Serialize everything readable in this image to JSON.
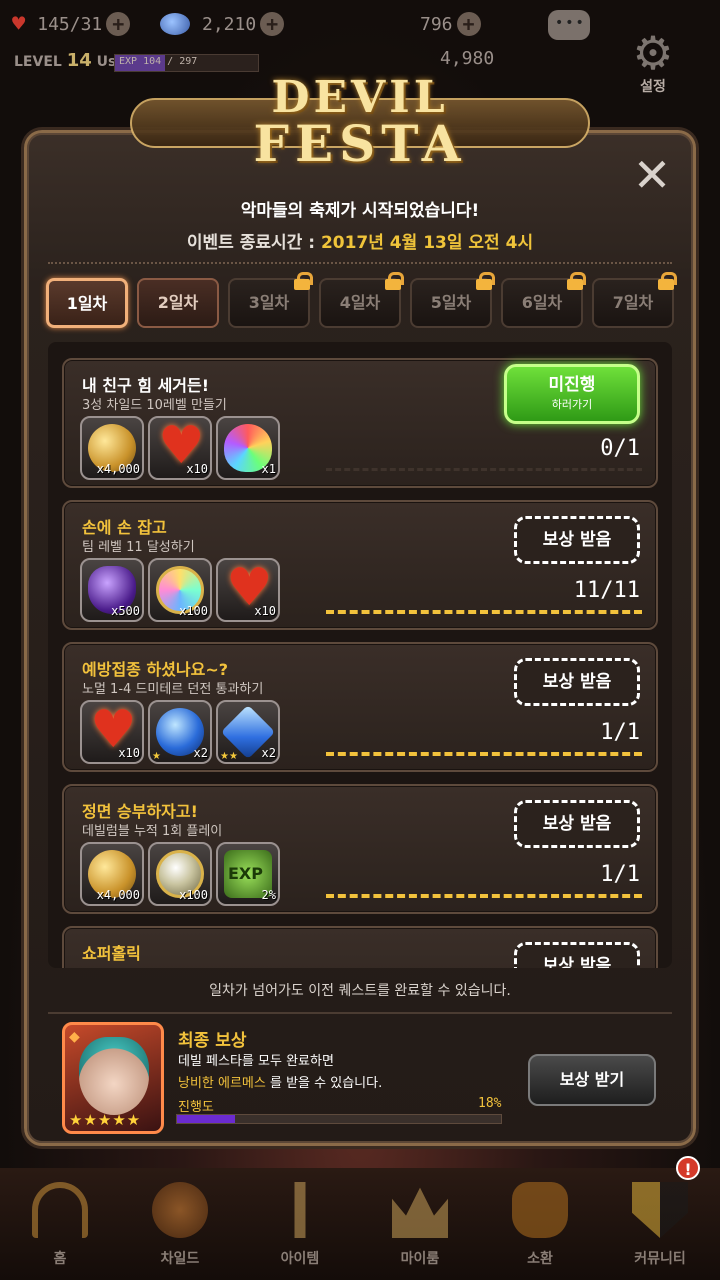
{
  "topbar": {
    "stamina": "145/31",
    "gems": "2,210",
    "gold": "796",
    "level_label": "LEVEL",
    "level": "14",
    "username": "Ussr",
    "exp_text": "EXP 104 / 297",
    "exp_progress": 0.35,
    "gold2": "4,980",
    "settings_label": "설정"
  },
  "logo": {
    "line1": "DEVIL",
    "line2": "FESTA"
  },
  "event": {
    "announcement": "악마들의 축제가 시작되었습니다!",
    "end_label": "이벤트 종료시간 :",
    "end_time": "2017년 4월 13일 오전 4시"
  },
  "tabs": [
    {
      "label": "1일차",
      "state": "active"
    },
    {
      "label": "2일차",
      "state": "open"
    },
    {
      "label": "3일차",
      "state": "locked"
    },
    {
      "label": "4일차",
      "state": "locked"
    },
    {
      "label": "5일차",
      "state": "locked"
    },
    {
      "label": "6일차",
      "state": "locked"
    },
    {
      "label": "7일차",
      "state": "locked"
    }
  ],
  "quests": [
    {
      "title": "내 친구 힘 세거든!",
      "subtitle": "3성 차일드 10레벨 만들기",
      "button": "미진행",
      "button_sub": "하러가기",
      "count": "0/1",
      "progress": 0,
      "items": [
        {
          "icon": "gold-coins-icon",
          "qty": "x4,000"
        },
        {
          "icon": "heart-icon",
          "qty": "x10"
        },
        {
          "icon": "rainbow-essence-icon",
          "qty": "x1"
        }
      ]
    },
    {
      "title": "손에 손 잡고",
      "subtitle": "팀 레벨 11 달성하기",
      "button": "보상 받음",
      "count": "11/11",
      "progress": 1,
      "items": [
        {
          "icon": "purple-crystal-icon",
          "qty": "x500"
        },
        {
          "icon": "opal-gem-icon",
          "qty": "x100"
        },
        {
          "icon": "heart-icon",
          "qty": "x10"
        }
      ]
    },
    {
      "title": "예방접종 하셨나요~?",
      "subtitle": "노멀 1-4 드미테르 던전 통과하기",
      "button": "보상 받음",
      "count": "1/1",
      "progress": 1,
      "items": [
        {
          "icon": "heart-icon",
          "qty": "x10",
          "stars": ""
        },
        {
          "icon": "blue-orb-icon",
          "qty": "x2",
          "stars": "★"
        },
        {
          "icon": "blue-gem-icon",
          "qty": "x2",
          "stars": "★★"
        }
      ]
    },
    {
      "title": "정면 승부하자고!",
      "subtitle": "데빌럼블 누적 1회 플레이",
      "button": "보상 받음",
      "count": "1/1",
      "progress": 1,
      "items": [
        {
          "icon": "gold-coins-icon",
          "qty": "x4,000"
        },
        {
          "icon": "silver-coin-icon",
          "qty": "x100"
        },
        {
          "icon": "user-exp-icon",
          "qty": "2%"
        }
      ]
    },
    {
      "title": "쇼퍼홀릭",
      "subtitle": "",
      "button": "보상 받음",
      "count": "",
      "progress": 0,
      "items": []
    }
  ],
  "note": "일차가 넘어가도 이전 퀘스트를 완료할 수 있습니다.",
  "final_reward": {
    "title": "최종 보상",
    "line1": "데빌 페스타를 모두 완료하면",
    "line2_highlight": "낭비한 에르메스",
    "line2_rest": " 를 받을 수 있습니다.",
    "progress_label": "진행도",
    "progress_pct": "18%",
    "progress": 0.18,
    "stars": "★★★★★",
    "claim_button": "보상 받기"
  },
  "nav": [
    {
      "label": "홈",
      "icon": "home-icon"
    },
    {
      "label": "차일드",
      "icon": "child-icon"
    },
    {
      "label": "아이템",
      "icon": "item-icon"
    },
    {
      "label": "마이룸",
      "icon": "myroom-icon"
    },
    {
      "label": "소환",
      "icon": "summon-icon"
    },
    {
      "label": "커뮤니티",
      "icon": "community-icon"
    }
  ],
  "nav_badge": "!",
  "colors": {
    "accent": "#f2c23c",
    "go_button": "#4cc322",
    "progress_fill": "#6b2bd0"
  }
}
